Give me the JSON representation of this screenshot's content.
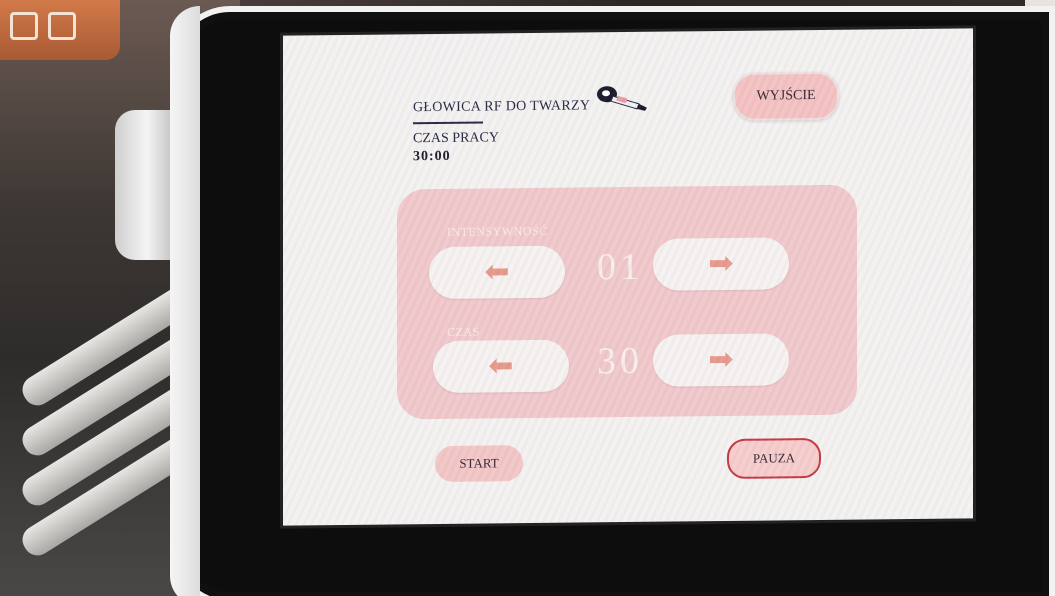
{
  "header": {
    "title": "GŁOWICA RF DO TWARZY",
    "icon": "rf-handpiece-icon",
    "exit_label": "WYJŚCIE"
  },
  "work_time": {
    "label": "CZAS PRACY",
    "value": "30:00"
  },
  "controls": {
    "intensity": {
      "label": "INTENSYWNOŚĆ",
      "value": "01"
    },
    "time": {
      "label": "CZAS",
      "value": "30"
    }
  },
  "icons": {
    "decrease": "left-arrow-icon",
    "increase": "right-arrow-icon"
  },
  "footer": {
    "start_label": "START",
    "pause_label": "PAUZA"
  },
  "colors": {
    "panel": "#f1c9cc",
    "arrow": "#e8998d",
    "pause_border": "#c63a44",
    "text": "#2a2a44"
  }
}
